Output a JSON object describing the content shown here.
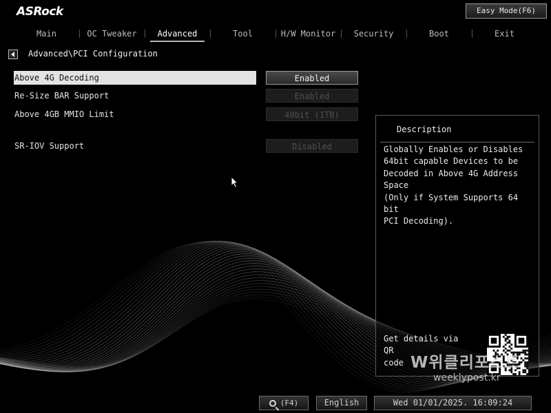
{
  "header": {
    "brand": "ASRock",
    "easy_mode_label": "Easy Mode(F6)"
  },
  "tabs": [
    {
      "label": "Main"
    },
    {
      "label": "OC Tweaker"
    },
    {
      "label": "Advanced"
    },
    {
      "label": "Tool"
    },
    {
      "label": "H/W Monitor"
    },
    {
      "label": "Security"
    },
    {
      "label": "Boot"
    },
    {
      "label": "Exit"
    }
  ],
  "active_tab": "Advanced",
  "breadcrumb": "Advanced\\PCI Configuration",
  "settings": [
    {
      "label": "Above 4G Decoding",
      "value": "Enabled",
      "state": "selected"
    },
    {
      "label": "Re-Size BAR Support",
      "value": "Enabled",
      "state": "disabled"
    },
    {
      "label": "Above 4GB MMIO Limit",
      "value": "40bit (1TB)",
      "state": "disabled"
    },
    {
      "label": "SR-IOV Support",
      "value": "Disabled",
      "state": "disabled"
    }
  ],
  "description": {
    "title": "Description",
    "lines": [
      "Globally Enables or Disables",
      "64bit capable Devices to be",
      "Decoded in Above 4G Address Space",
      "(Only if System Supports 64 bit",
      "PCI Decoding)."
    ],
    "qr_lines": [
      "Get details via QR",
      "code"
    ]
  },
  "watermark": {
    "primary": "W위클리포스트",
    "secondary": "weeklypost.kr"
  },
  "footer": {
    "search_key": "(F4)",
    "language": "English",
    "datetime": "Wed 01/01/2025. 16:09:24"
  },
  "colors": {
    "background": "#000000",
    "selected_row": "#e3e3e3",
    "disabled_text": "#505050",
    "panel_border": "#5a5a5a"
  }
}
